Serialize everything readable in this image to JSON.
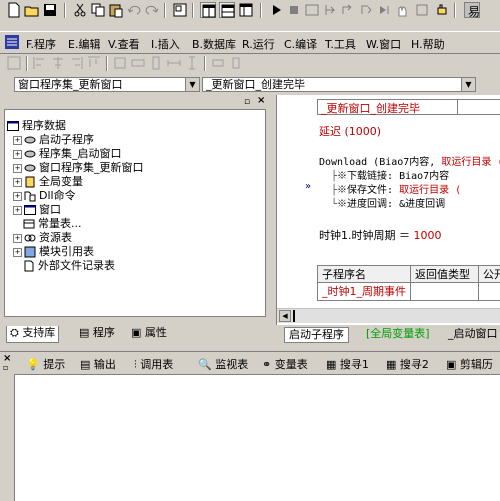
{
  "menu": [
    {
      "key": "F",
      "label": "F.程序"
    },
    {
      "key": "E",
      "label": "E.编辑"
    },
    {
      "key": "V",
      "label": "V.查看"
    },
    {
      "key": "I",
      "label": "I.插入"
    },
    {
      "key": "B",
      "label": "B.数据库"
    },
    {
      "key": "R",
      "label": "R.运行"
    },
    {
      "key": "C",
      "label": "C.编译"
    },
    {
      "key": "T",
      "label": "T.工具"
    },
    {
      "key": "W",
      "label": "W.窗口"
    },
    {
      "key": "H",
      "label": "H.帮助"
    }
  ],
  "combo": {
    "left_value": "窗口程序集_更新窗口",
    "right_value": "_更新窗口_创建完毕"
  },
  "tree": {
    "root": "程序数据",
    "items": [
      "启动子程序",
      "程序集_启动窗口",
      "窗口程序集_更新窗口",
      "全局变量",
      "Dll命令",
      "窗口",
      "常量表...",
      "资源表",
      "模块引用表",
      "外部文件记录表"
    ]
  },
  "left_tabs": [
    "支持库",
    "程序",
    "属性"
  ],
  "code": {
    "header_cell": "_更新窗口_创建完毕",
    "line1": "延迟 (1000)",
    "download_prefix": "Download (Biao7内容, ",
    "download_red": "取运行目录 (",
    "sub1_label": "※下载链接: ",
    "sub1_value": "Biao7内容",
    "sub2_label": "※保存文件: ",
    "sub2_value": "取运行目录 (",
    "sub3_label": "※进度回调: ",
    "sub3_value": "&进度回调",
    "timer_line": "时钟1.时钟周期 ＝ ",
    "timer_value": "1000",
    "table_headers": [
      "子程序名",
      "返回值类型",
      "公开"
    ],
    "table_row": "_时钟1_周期事件"
  },
  "right_tabs": [
    "启动子程序",
    "[全局变量表]",
    "_启动窗口"
  ],
  "output_tabs": [
    "提示",
    "输出",
    "调用表",
    "监视表",
    "变量表",
    "搜寻1",
    "搜寻2",
    "剪辑历"
  ]
}
